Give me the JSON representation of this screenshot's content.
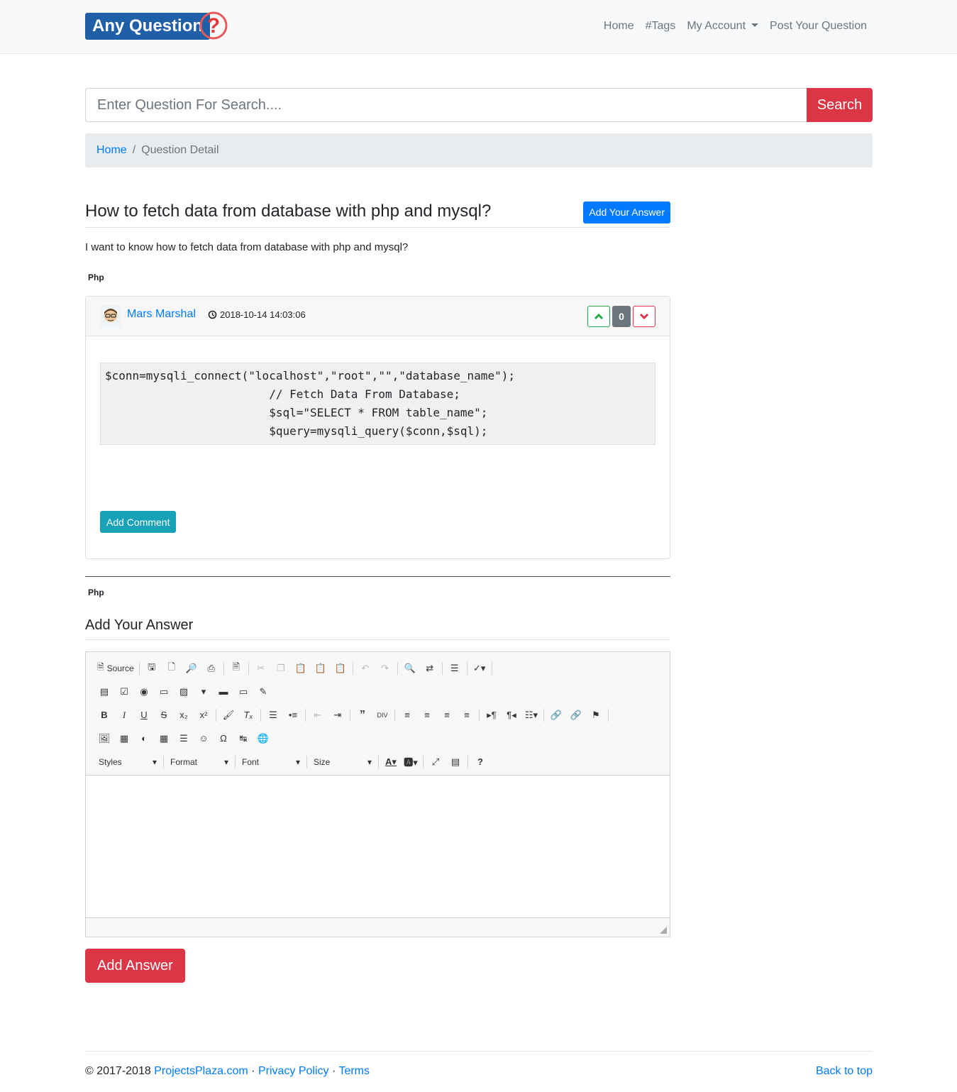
{
  "brand": {
    "name": "Any Question"
  },
  "nav": {
    "home": "Home",
    "tags": "#Tags",
    "account": "My Account",
    "post": "Post Your Question"
  },
  "search": {
    "placeholder": "Enter Question For Search....",
    "button": "Search"
  },
  "breadcrumb": {
    "home": "Home",
    "separator": "/",
    "current": "Question Detail"
  },
  "question": {
    "title": "How to fetch data from database with php and mysql?",
    "add_answer_label": "Add Your Answer",
    "body": "I want to know how to fetch data from database with php and mysql?",
    "tag": "Php"
  },
  "answer": {
    "author": "Mars Marshal",
    "datetime": "2018-10-14 14:03:06",
    "votes": "0",
    "code": "$conn=mysqli_connect(\"localhost\",\"root\",\"\",\"database_name\");\n                        // Fetch Data From Database;\n                        $sql=\"SELECT * FROM table_name\";\n                        $query=mysqli_query($conn,$sql);",
    "add_comment_label": "Add Comment",
    "tag": "Php"
  },
  "answer_form": {
    "heading": "Add Your Answer",
    "submit_label": "Add Answer",
    "editor": {
      "source_label": "Source",
      "styles_label": "Styles",
      "format_label": "Format",
      "font_label": "Font",
      "size_label": "Size"
    }
  },
  "footer": {
    "copyright": "© 2017-2018",
    "site": "ProjectsPlaza.com",
    "dot1": "·",
    "privacy": "Privacy Policy",
    "dot2": "·",
    "terms": "Terms",
    "back_to_top": "Back to top"
  },
  "colors": {
    "primary": "#007bff",
    "danger": "#dc3545",
    "success": "#28a745",
    "info": "#17a2b8",
    "secondary": "#6c757d",
    "logo_blue": "#1f5fa8"
  }
}
